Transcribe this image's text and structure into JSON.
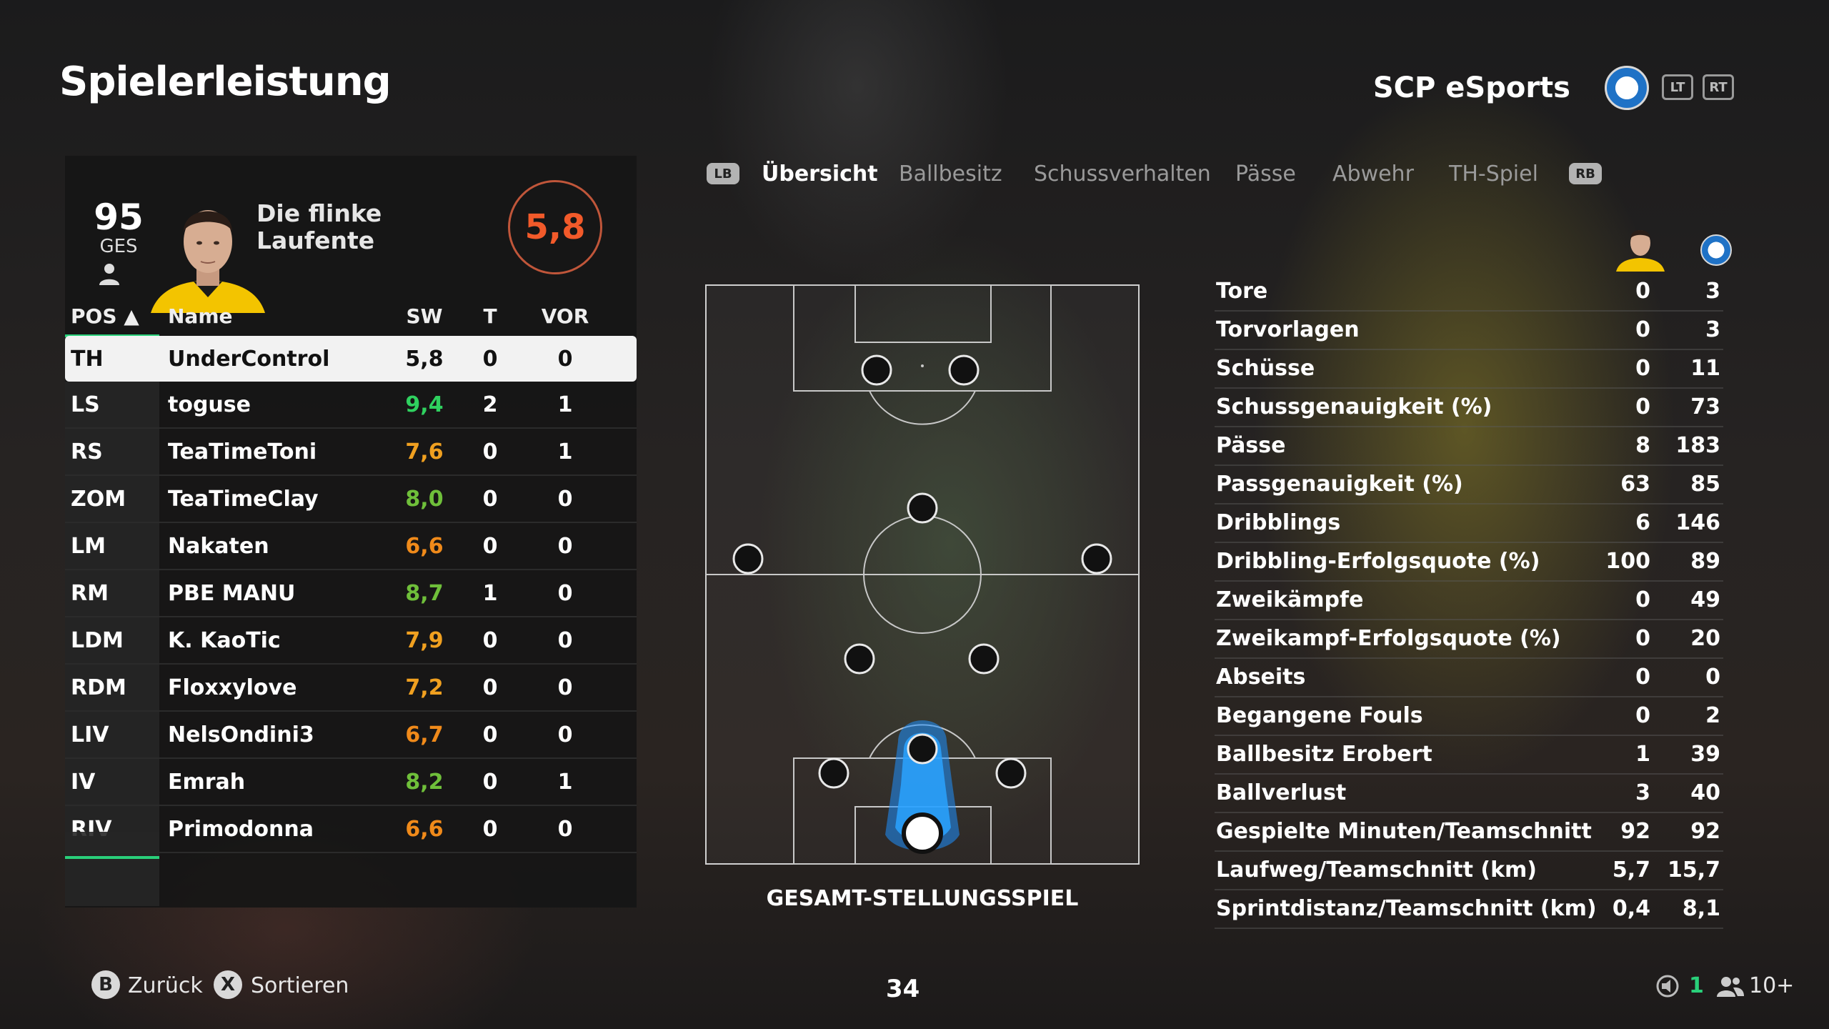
{
  "header": {
    "title": "Spielerleistung",
    "team": "SCP eSports",
    "crest_text": "SC PADERBORN 07",
    "bumpers": {
      "lt": "LT",
      "rt": "RT"
    }
  },
  "player_card": {
    "overall": "95",
    "overall_label": "GES",
    "nickname": "Die flinke Laufente",
    "rating": "5,8"
  },
  "table": {
    "headers": {
      "pos": "POS ▲",
      "name": "Name",
      "sw": "SW",
      "t": "T",
      "vor": "VOR"
    },
    "rows": [
      {
        "pos": "TH",
        "name": "UnderControl",
        "sw": "5,8",
        "t": "0",
        "vor": "0",
        "color": "#111111"
      },
      {
        "pos": "LS",
        "name": "toguse",
        "sw": "9,4",
        "t": "2",
        "vor": "1",
        "color": "#2fd15f"
      },
      {
        "pos": "RS",
        "name": "TeaTimeToni",
        "sw": "7,6",
        "t": "0",
        "vor": "1",
        "color": "#f0a020"
      },
      {
        "pos": "ZOM",
        "name": "TeaTimeClay",
        "sw": "8,0",
        "t": "0",
        "vor": "0",
        "color": "#6fbf3a"
      },
      {
        "pos": "LM",
        "name": "Nakaten",
        "sw": "6,6",
        "t": "0",
        "vor": "0",
        "color": "#f08a1a"
      },
      {
        "pos": "RM",
        "name": "PBE MANU",
        "sw": "8,7",
        "t": "1",
        "vor": "0",
        "color": "#6fbf3a"
      },
      {
        "pos": "LDM",
        "name": "K. KaoTic",
        "sw": "7,9",
        "t": "0",
        "vor": "0",
        "color": "#f0a020"
      },
      {
        "pos": "RDM",
        "name": "Floxxylove",
        "sw": "7,2",
        "t": "0",
        "vor": "0",
        "color": "#f0a020"
      },
      {
        "pos": "LIV",
        "name": "NelsOndini3",
        "sw": "6,7",
        "t": "0",
        "vor": "0",
        "color": "#f08a1a"
      },
      {
        "pos": "IV",
        "name": "Emrah",
        "sw": "8,2",
        "t": "0",
        "vor": "1",
        "color": "#6fbf3a"
      },
      {
        "pos": "RIV",
        "name": "Primodonna",
        "sw": "6,6",
        "t": "0",
        "vor": "0",
        "color": "#f08a1a"
      }
    ]
  },
  "tabs": {
    "lb": "LB",
    "rb": "RB",
    "items": [
      "Übersicht",
      "Ballbesitz",
      "Schussverhalten",
      "Pässe",
      "Abwehr",
      "TH-Spiel"
    ],
    "active_index": 0
  },
  "pitch": {
    "caption": "GESAMT-STELLUNGSSPIEL",
    "accent_color": "#1e8fff"
  },
  "stats": [
    {
      "label": "Tore",
      "player": "0",
      "team": "3"
    },
    {
      "label": "Torvorlagen",
      "player": "0",
      "team": "3"
    },
    {
      "label": "Schüsse",
      "player": "0",
      "team": "11"
    },
    {
      "label": "Schussgenauigkeit (%)",
      "player": "0",
      "team": "73"
    },
    {
      "label": "Pässe",
      "player": "8",
      "team": "183"
    },
    {
      "label": "Passgenauigkeit (%)",
      "player": "63",
      "team": "85"
    },
    {
      "label": "Dribblings",
      "player": "6",
      "team": "146"
    },
    {
      "label": "Dribbling-Erfolgsquote (%)",
      "player": "100",
      "team": "89"
    },
    {
      "label": "Zweikämpfe",
      "player": "0",
      "team": "49"
    },
    {
      "label": "Zweikampf-Erfolgsquote (%)",
      "player": "0",
      "team": "20"
    },
    {
      "label": "Abseits",
      "player": "0",
      "team": "0"
    },
    {
      "label": "Begangene Fouls",
      "player": "0",
      "team": "2"
    },
    {
      "label": "Ballbesitz Erobert",
      "player": "1",
      "team": "39"
    },
    {
      "label": "Ballverlust",
      "player": "3",
      "team": "40"
    },
    {
      "label": "Gespielte Minuten/Teamschnitt",
      "player": "92",
      "team": "92"
    },
    {
      "label": "Laufweg/Teamschnitt (km)",
      "player": "5,7",
      "team": "15,7"
    },
    {
      "label": "Sprintdistanz/Teamschnitt (km)",
      "player": "0,4",
      "team": "8,1"
    }
  ],
  "footer": {
    "back_button": "B",
    "back_label": "Zurück",
    "sort_button": "X",
    "sort_label": "Sortieren",
    "page": "34",
    "mic_count": "1",
    "party_count": "10+"
  }
}
